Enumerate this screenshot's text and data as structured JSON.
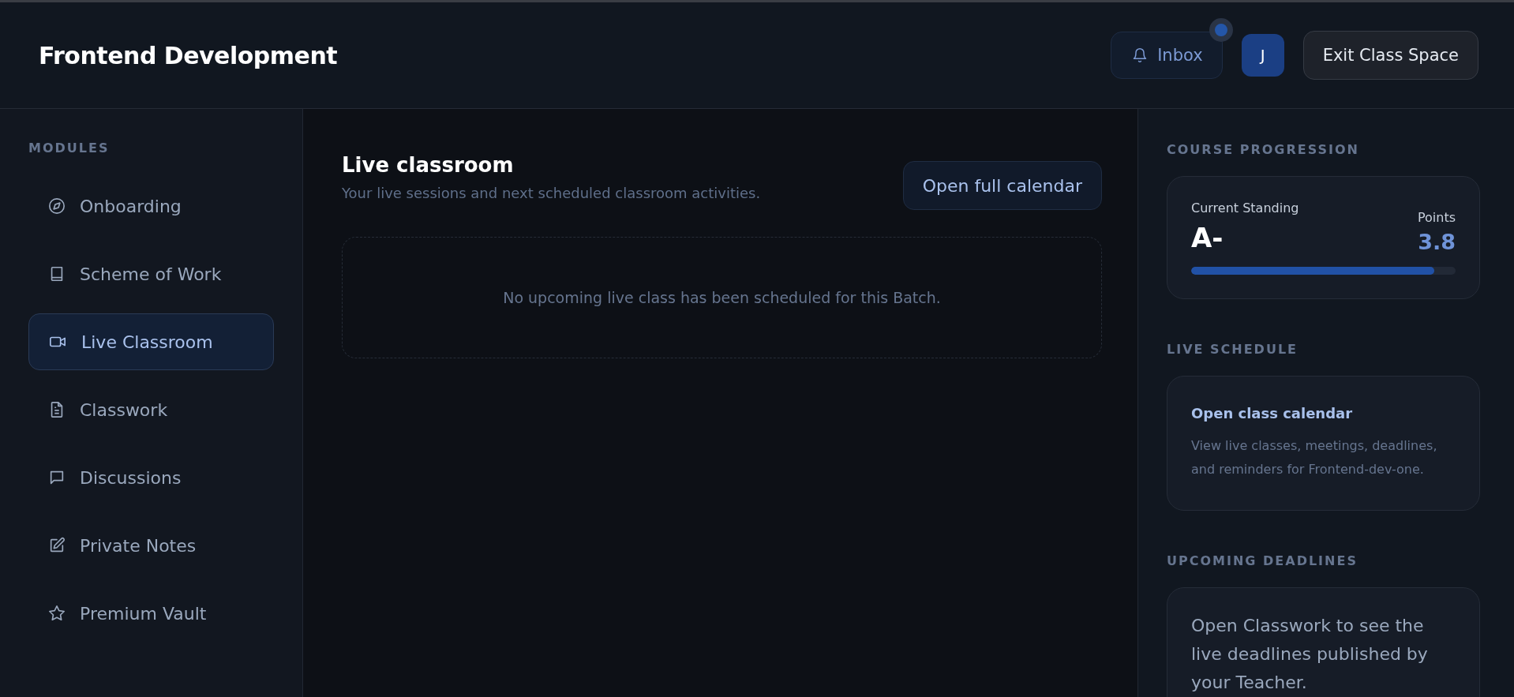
{
  "header": {
    "title": "Frontend Development",
    "inbox": {
      "label": "Inbox",
      "unread": true
    },
    "avatar": "J",
    "exit_button": "Exit Class Space"
  },
  "sidebar": {
    "heading": "MODULES",
    "items": [
      {
        "label": "Onboarding",
        "selected": false
      },
      {
        "label": "Scheme of Work",
        "selected": false
      },
      {
        "label": "Live Classroom",
        "selected": true
      },
      {
        "label": "Classwork",
        "selected": false
      },
      {
        "label": "Discussions",
        "selected": false
      },
      {
        "label": "Private Notes",
        "selected": false
      },
      {
        "label": "Premium Vault",
        "selected": false
      }
    ]
  },
  "main": {
    "title": "Live classroom",
    "subtitle": "Your live sessions and next scheduled classroom activities.",
    "button": "Open full calendar",
    "empty_message": "No upcoming live class has been scheduled for this Batch."
  },
  "right_panel": {
    "progression": {
      "heading": "COURSE PROGRESSION",
      "standing_label": "Current Standing",
      "grade": "A-",
      "points_label": "Points",
      "points": "3.8",
      "level": 0.92
    },
    "schedule": {
      "heading": "LIVE SCHEDULE",
      "link": "Open class calendar",
      "description": "View live classes, meetings, deadlines, and reminders for Frontend-dev-one."
    },
    "deadlines": {
      "heading": "UPCOMING DEADLINES",
      "message": "Open Classwork to see the live deadlines published by your Teacher."
    }
  }
}
